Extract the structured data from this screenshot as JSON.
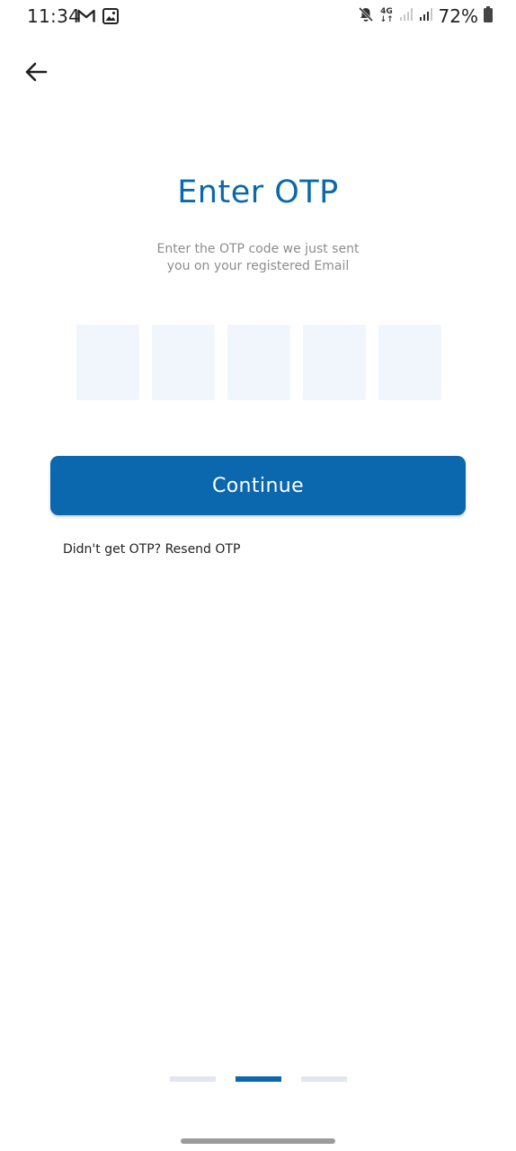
{
  "status_bar": {
    "time": "11:34",
    "left_icons": [
      "gmail-icon",
      "gallery-icon"
    ],
    "right_icons": [
      "mute-icon",
      "network-4g-icon",
      "signal-icon",
      "signal-icon",
      "battery-icon"
    ],
    "network_label_top": "4G",
    "network_label_bottom": "↓↑",
    "battery_percent": "72%"
  },
  "header": {
    "back_icon": "arrow-left-icon"
  },
  "main": {
    "title": "Enter OTP",
    "subtitle_line1": "Enter the OTP code we just sent",
    "subtitle_line2": "you on your registered Email",
    "otp_digits": [
      "",
      "",
      "",
      "",
      ""
    ],
    "continue_label": "Continue",
    "resend_prompt": "Didn't get OTP?",
    "resend_link": "Resend OTP"
  },
  "pager": {
    "count": 3,
    "active_index": 1
  },
  "colors": {
    "accent": "#0b68ae",
    "title": "#0a68ad",
    "otp_box_bg": "#f1f6fc",
    "pager_inactive": "#e3e6ef"
  }
}
